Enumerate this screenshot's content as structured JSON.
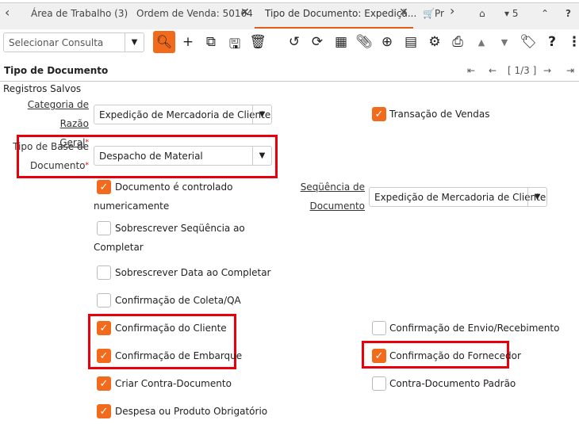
{
  "tabs": [
    {
      "label": "Área de Trabalho (3)"
    },
    {
      "label": "Ordem de Venda: 50164",
      "closable": true
    },
    {
      "label": "Tipo de Documento: Expediçã...",
      "closable": true,
      "active": true
    },
    {
      "label": "Pr"
    }
  ],
  "tabbar_right": {
    "count": "5"
  },
  "toolbar": {
    "query_placeholder": "Selecionar Consulta"
  },
  "page": {
    "title": "Tipo de Documento",
    "record_nav": "1/3"
  },
  "form": {
    "saved_records": "Registros Salvos",
    "gl_category_label_1": "Categoria de Razão",
    "gl_category_label_2": "Geral",
    "gl_category_value": "Expedição de Mercadoria de Cliente",
    "base_type_label_1": "Tipo de Base de",
    "base_type_label_2": "Documento",
    "base_type_value": "Despacho de Material",
    "seq_label_1": "Seqüência de",
    "seq_label_2": "Documento",
    "seq_value": "Expedição de Mercadoria de Cliente",
    "checkboxes": [
      {
        "label": "Transação de Vendas",
        "checked": true
      },
      {
        "label": "Documento é controlado",
        "label2": "numericamente",
        "checked": true
      },
      {
        "label": "Sobrescrever Seqüência ao",
        "label2": "Completar",
        "checked": false
      },
      {
        "label": "Sobrescrever Data ao Completar",
        "checked": false
      },
      {
        "label": "Confirmação de Coleta/QA",
        "checked": false
      },
      {
        "label": "Confirmação do Cliente",
        "checked": true
      },
      {
        "label": "Confirmação de Embarque",
        "checked": true
      },
      {
        "label": "Criar Contra-Documento",
        "checked": true
      },
      {
        "label": "Despesa ou Produto Obrigatório",
        "checked": true
      },
      {
        "label": "Confirmação de Envio/Recebimento",
        "checked": false
      },
      {
        "label": "Confirmação do Fornecedor",
        "checked": true
      },
      {
        "label": "Contra-Documento Padrão",
        "checked": false
      }
    ]
  }
}
